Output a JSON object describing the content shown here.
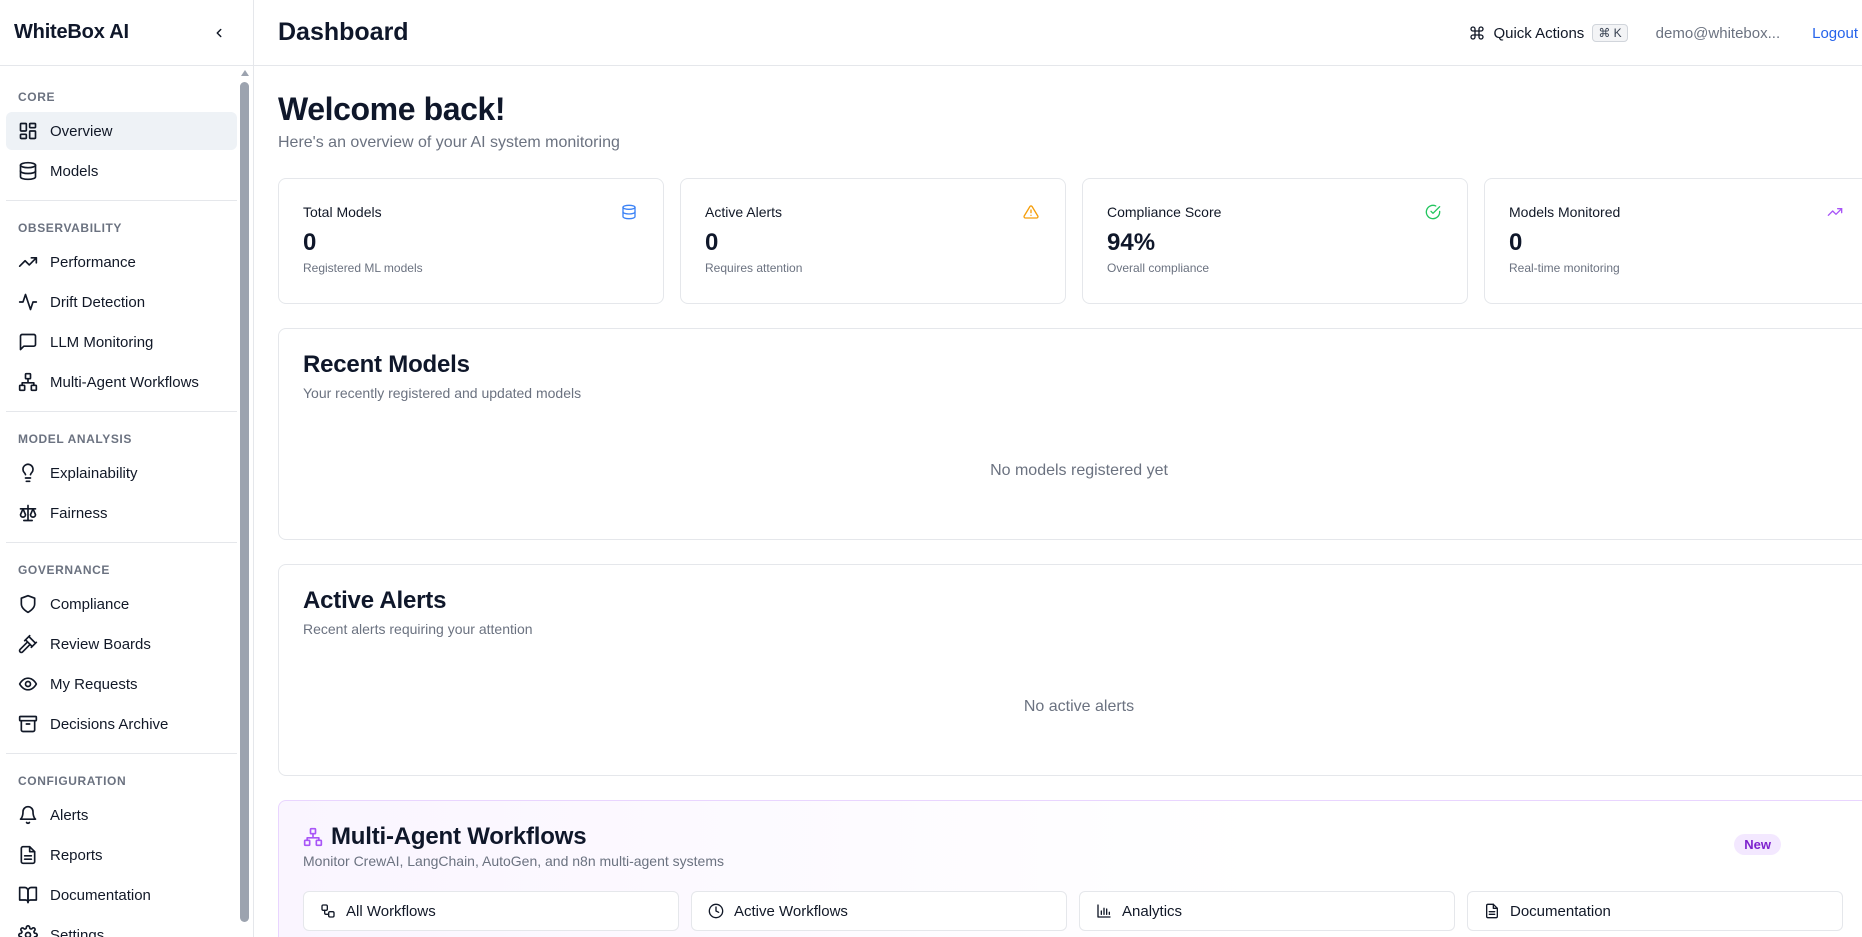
{
  "app": {
    "brand": "WhiteBox AI"
  },
  "sidebar": {
    "sections": [
      {
        "label": "CORE",
        "items": [
          {
            "label": "Overview",
            "icon": "grid-icon",
            "active": true
          },
          {
            "label": "Models",
            "icon": "database-icon"
          }
        ]
      },
      {
        "label": "OBSERVABILITY",
        "items": [
          {
            "label": "Performance",
            "icon": "trending-up-icon"
          },
          {
            "label": "Drift Detection",
            "icon": "activity-icon"
          },
          {
            "label": "LLM Monitoring",
            "icon": "message-square-icon"
          },
          {
            "label": "Multi-Agent Workflows",
            "icon": "network-icon"
          }
        ]
      },
      {
        "label": "MODEL ANALYSIS",
        "items": [
          {
            "label": "Explainability",
            "icon": "lightbulb-icon"
          },
          {
            "label": "Fairness",
            "icon": "scale-icon"
          }
        ]
      },
      {
        "label": "GOVERNANCE",
        "items": [
          {
            "label": "Compliance",
            "icon": "shield-icon"
          },
          {
            "label": "Review Boards",
            "icon": "gavel-icon"
          },
          {
            "label": "My Requests",
            "icon": "eye-icon"
          },
          {
            "label": "Decisions Archive",
            "icon": "archive-icon"
          }
        ]
      },
      {
        "label": "CONFIGURATION",
        "items": [
          {
            "label": "Alerts",
            "icon": "bell-icon"
          },
          {
            "label": "Reports",
            "icon": "file-text-icon"
          },
          {
            "label": "Documentation",
            "icon": "book-open-icon"
          },
          {
            "label": "Settings",
            "icon": "gear-icon"
          }
        ]
      }
    ]
  },
  "header": {
    "title": "Dashboard",
    "quick_actions": "Quick Actions",
    "shortcut": "⌘ K",
    "user_email": "demo@whitebox...",
    "logout": "Logout"
  },
  "welcome": {
    "title": "Welcome back!",
    "subtitle": "Here's an overview of your AI system monitoring"
  },
  "stats": [
    {
      "label": "Total Models",
      "value": "0",
      "sub": "Registered ML models",
      "icon": "database-icon",
      "color": "#3b82f6"
    },
    {
      "label": "Active Alerts",
      "value": "0",
      "sub": "Requires attention",
      "icon": "warning-icon",
      "color": "#f59e0b"
    },
    {
      "label": "Compliance Score",
      "value": "94%",
      "sub": "Overall compliance",
      "icon": "check-circle-icon",
      "color": "#22c55e"
    },
    {
      "label": "Models Monitored",
      "value": "0",
      "sub": "Real-time monitoring",
      "icon": "trending-up-icon",
      "color": "#a855f7"
    }
  ],
  "recent_models": {
    "title": "Recent Models",
    "subtitle": "Your recently registered and updated models",
    "empty": "No models registered yet"
  },
  "active_alerts": {
    "title": "Active Alerts",
    "subtitle": "Recent alerts requiring your attention",
    "empty": "No active alerts"
  },
  "workflows": {
    "title": "Multi-Agent Workflows",
    "subtitle": "Monitor CrewAI, LangChain, AutoGen, and n8n multi-agent systems",
    "badge": "New",
    "buttons": [
      {
        "label": "All Workflows",
        "icon": "workflow-icon"
      },
      {
        "label": "Active Workflows",
        "icon": "clock-icon"
      },
      {
        "label": "Analytics",
        "icon": "bar-chart-icon"
      },
      {
        "label": "Documentation",
        "icon": "file-text-icon"
      }
    ]
  },
  "colors": {
    "accent": "#2563eb",
    "purple": "#a855f7",
    "active_bg": "#eef2f6"
  }
}
